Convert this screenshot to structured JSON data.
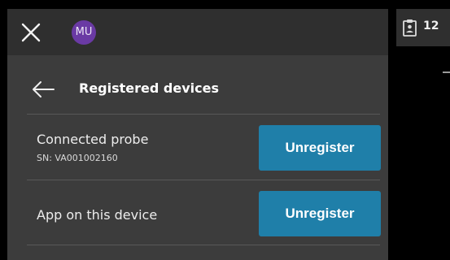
{
  "header": {
    "avatar_initials": "MU"
  },
  "page": {
    "title": "Registered devices"
  },
  "devices": [
    {
      "title": "Connected probe",
      "serial": "SN: VA001002160",
      "action_label": "Unregister"
    },
    {
      "title": "App on this device",
      "action_label": "Unregister"
    }
  ],
  "side": {
    "count": "12",
    "icon": "clipboard-user-icon"
  },
  "colors": {
    "panel": "#3c3c3c",
    "topbar": "#2f2f2f",
    "accent": "#1f7fa9",
    "avatar": "#6a3aa4"
  }
}
